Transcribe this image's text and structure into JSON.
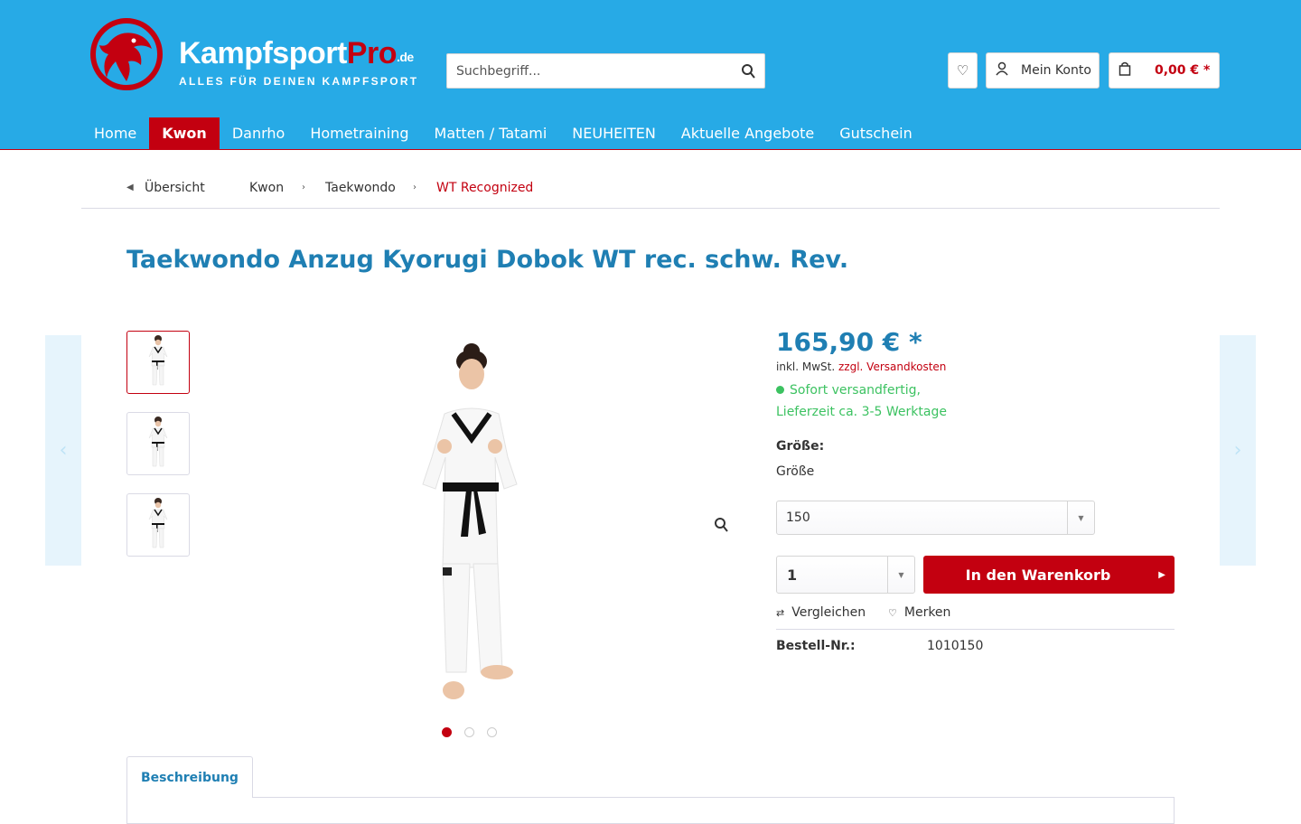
{
  "header": {
    "logo": {
      "name": "Kampfsport",
      "pro": "Pro",
      "tld": ".de",
      "tagline": "ALLES FÜR DEINEN KAMPFSPORT"
    },
    "search": {
      "placeholder": "Suchbegriff...",
      "icon": "search-icon"
    },
    "account_label": "Mein Konto",
    "cart_amount": "0,00 € *"
  },
  "nav": [
    "Home",
    "Kwon",
    "Danrho",
    "Hometraining",
    "Matten / Tatami",
    "NEUHEITEN",
    "Aktuelle Angebote",
    "Gutschein"
  ],
  "nav_active": "Kwon",
  "breadcrumb": {
    "overview": "Übersicht",
    "items": [
      "Kwon",
      "Taekwondo",
      "WT Recognized"
    ]
  },
  "product": {
    "title": "Taekwondo Anzug Kyorugi Dobok WT rec. schw. Rev.",
    "price": "165,90 € *",
    "tax_prefix": "inkl. MwSt.",
    "tax_link": "zzgl. Versandkosten",
    "stock_line1": "Sofort versandfertig,",
    "stock_line2": "Lieferzeit ca. 3-5 Werktage",
    "size_label": "Größe:",
    "size_sub": "Größe",
    "size_value": "150",
    "qty_value": "1",
    "add_to_cart": "In den Warenkorb",
    "compare": "Vergleichen",
    "remember": "Merken",
    "order_no_label": "Bestell-Nr.:",
    "order_no": "1010150"
  },
  "gallery": {
    "thumb_count": 3,
    "active_index": 0
  },
  "tabs": [
    "Beschreibung"
  ],
  "colors": {
    "brand_blue": "#27aae6",
    "brand_red": "#c30010",
    "title_blue": "#1f7fb3",
    "stock_green": "#3cc261"
  }
}
